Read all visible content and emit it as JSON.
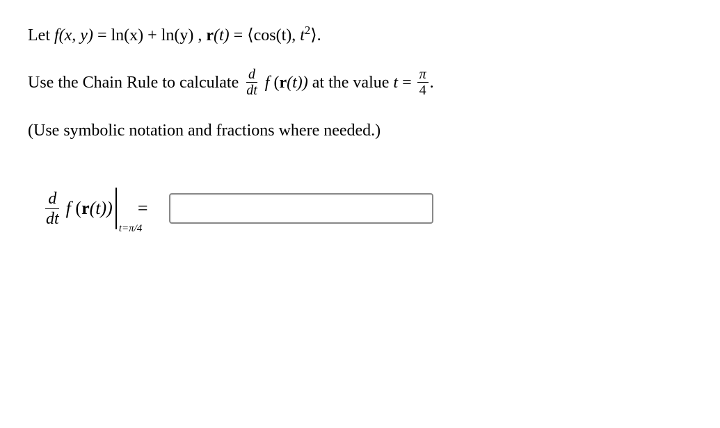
{
  "problem": {
    "line1_prefix": "Let ",
    "f_def_lhs": "f(x, y)",
    "equals1": " = ",
    "f_def_rhs": "ln(x) + ln(y)",
    "comma_sep": ", ",
    "r_def_lhs_r": "r",
    "r_def_lhs_t": "(t)",
    "equals2": " = ",
    "langle": "⟨",
    "r_comp1": "cos(t)",
    "r_comma": ", ",
    "r_comp2_base": "t",
    "r_comp2_exp": "2",
    "rangle": "⟩",
    "period1": ".",
    "line2_prefix": "Use the Chain Rule to calculate ",
    "deriv_num": "d",
    "deriv_den": "dt",
    "f_of_r_f": "f",
    "f_of_r_open": " (",
    "f_of_r_r": "r",
    "f_of_r_t": "(t))",
    "line2_mid": " at the value ",
    "t_var": "t",
    "equals3": " = ",
    "pi_num": "π",
    "pi_den": "4",
    "period2": ".",
    "line3": "(Use symbolic notation and fractions where needed.)"
  },
  "answer": {
    "deriv_num": "d",
    "deriv_den": "dt",
    "f_label": "f",
    "r_open": " (",
    "r_bold": "r",
    "r_rest": "(t))",
    "eval_sub": "t=π/4",
    "equals": "=",
    "input_value": ""
  }
}
